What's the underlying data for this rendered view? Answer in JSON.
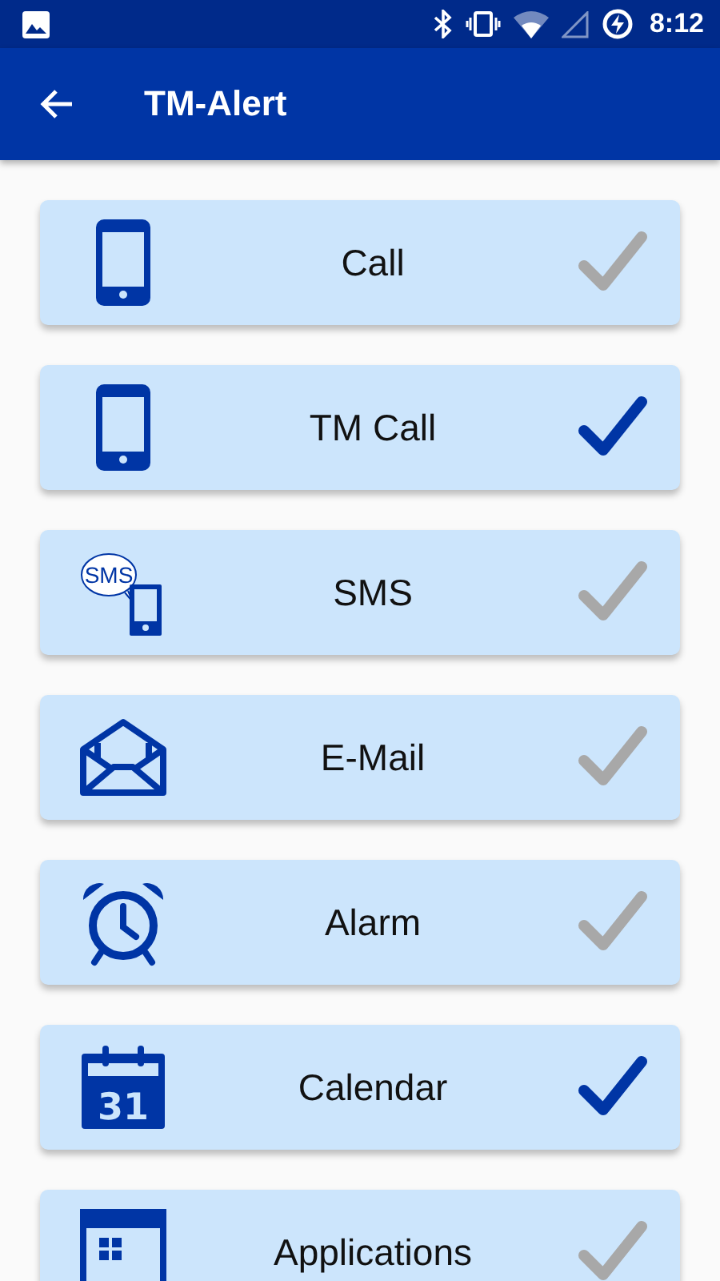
{
  "status_bar": {
    "time": "8:12"
  },
  "app_bar": {
    "title": "TM-Alert"
  },
  "items": [
    {
      "kind": "phone",
      "label": "Call",
      "checked": false
    },
    {
      "kind": "phone",
      "label": "TM Call",
      "checked": true
    },
    {
      "kind": "sms",
      "label": "SMS",
      "icon_text": "SMS",
      "checked": false
    },
    {
      "kind": "mail",
      "label": "E-Mail",
      "checked": false
    },
    {
      "kind": "alarm",
      "label": "Alarm",
      "checked": false
    },
    {
      "kind": "calendar",
      "label": "Calendar",
      "icon_text": "31",
      "checked": true
    },
    {
      "kind": "apps",
      "label": "Applications",
      "checked": false
    }
  ]
}
